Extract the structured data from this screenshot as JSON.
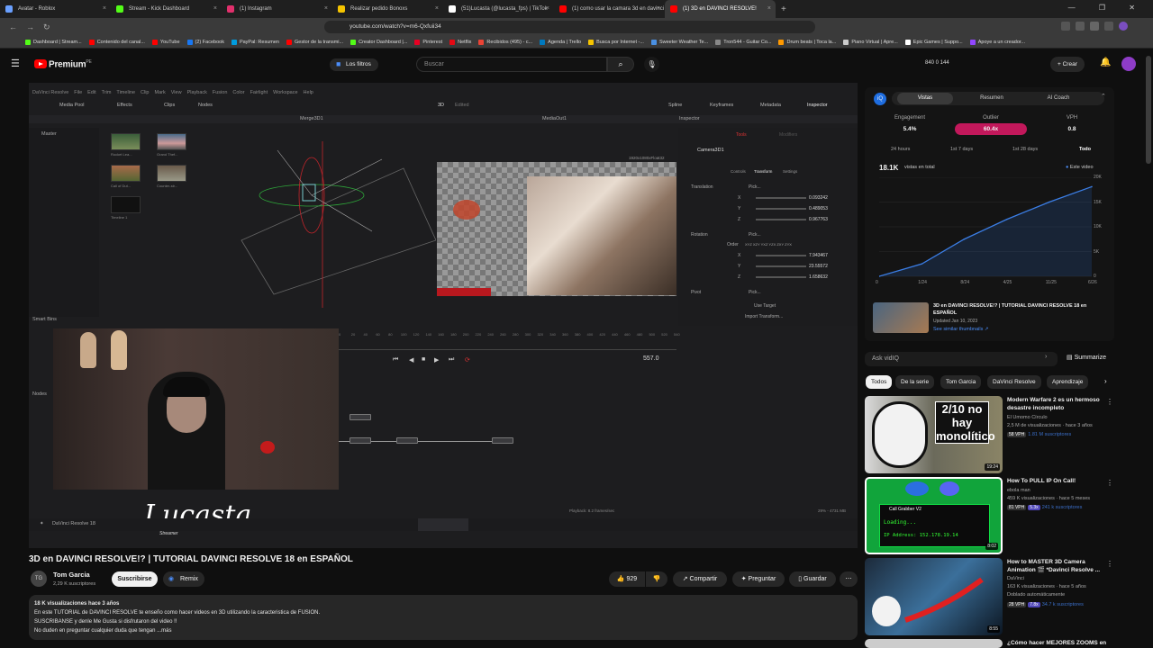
{
  "browser": {
    "tabs": [
      {
        "label": "Avatar - Roblox",
        "color": "#6aa0ff"
      },
      {
        "label": "Stream - Kick Dashboard",
        "color": "#53fc18"
      },
      {
        "label": "(1) Instagram",
        "color": "#e1306c"
      },
      {
        "label": "Realizar pedido Bonoxs",
        "color": "#f5c400"
      },
      {
        "label": "(51)Lucasta (@lucasta_fps) | TikTok",
        "color": "#ffffff"
      },
      {
        "label": "(1) como usar la camara 3d en davinci",
        "color": "#ff0000"
      },
      {
        "label": "(1) 3D en DAVINCI RESOLVE!",
        "color": "#ff0000",
        "active": true
      }
    ],
    "url": "youtube.com/watch?v=m6-Qxfuii34",
    "bookmarks": [
      {
        "label": "Dashboard | Stream...",
        "color": "#53fc18"
      },
      {
        "label": "Contenido del canal...",
        "color": "#ff0000"
      },
      {
        "label": "YouTube",
        "color": "#ff0000"
      },
      {
        "label": "(2) Facebook",
        "color": "#1877f2"
      },
      {
        "label": "PayPal: Resumen",
        "color": "#009cde"
      },
      {
        "label": "Gestor de la transmi...",
        "color": "#ff0000"
      },
      {
        "label": "Creator Dashboard |...",
        "color": "#53fc18"
      },
      {
        "label": "Pinterest",
        "color": "#e60023"
      },
      {
        "label": "Netflix",
        "color": "#e50914"
      },
      {
        "label": "Recibidos (495) - c...",
        "color": "#ea4335"
      },
      {
        "label": "Agenda | Trello",
        "color": "#0079bf"
      },
      {
        "label": "Busca por Internet -...",
        "color": "#f5c400"
      },
      {
        "label": "Sweeter Weather Te...",
        "color": "#4a90e2"
      },
      {
        "label": "Tron544 - Guitar Co...",
        "color": "#888888"
      },
      {
        "label": "Drum beats | Toca la...",
        "color": "#ff9900"
      },
      {
        "label": "Piano Virtual | Apre...",
        "color": "#cccccc"
      },
      {
        "label": "Epic Games | Suppo...",
        "color": "#ffffff"
      },
      {
        "label": "Apoye a un creador...",
        "color": "#9146ff"
      }
    ]
  },
  "youtube": {
    "brand": "Premium",
    "region": "PE",
    "filter_chip": "Los filtros",
    "search_placeholder": "Buscar",
    "stats": "840  0  144",
    "create_label": "Crear"
  },
  "resolve": {
    "menu": [
      "DaVinci Resolve",
      "File",
      "Edit",
      "Trim",
      "Timeline",
      "Clip",
      "Mark",
      "View",
      "Playback",
      "Fusion",
      "Color",
      "Fairlight",
      "Workspace",
      "Help"
    ],
    "toolbar": {
      "media_pool": "Media Pool",
      "effects": "Effects",
      "clips": "Clips",
      "nodes": "Nodes",
      "view3d": "3D",
      "edited": "Edited",
      "spline": "Spline",
      "keyframes": "Keyframes",
      "metadata": "Metadata",
      "inspector": "Inspector"
    },
    "viewer_left": "Merge3D1",
    "viewer_right": "MediaOut1",
    "resolution": "1920x1080xFloat32",
    "master": "Master",
    "smart_bins": "Smart Bins",
    "nodes_title": "Nodes",
    "clips": [
      "Rocket Lea...",
      "Grand Thef...",
      "Call of Dut...",
      "Counter-str...",
      "Timeline 1"
    ],
    "inspector": {
      "title": "Inspector",
      "tools_tab": "Tools",
      "modifiers_tab": "Modifiers",
      "node": "Camera3D1",
      "sub_tabs": [
        "Controls",
        "Transform",
        "Settings"
      ],
      "translation_label": "Translation",
      "translation": [
        "0.093242",
        "0.489053",
        "0.967763"
      ],
      "rotation_label": "Rotation",
      "order_label": "Order",
      "order_values": "XYZ  XZY  YXZ  YZX  ZXY  ZYX",
      "rotation": [
        "7.943467",
        "23.55572",
        "1.658632"
      ],
      "pivot_label": "Pivot",
      "use_target": "Use Target",
      "import_transform": "Import Transform...",
      "pick": "Pick..."
    },
    "timecode": "557.0",
    "playback_info": "Playback: 8.2 frames/sec",
    "mem_info": "29% - 4731 MB",
    "app_name": "DaVinci Resolve 18",
    "timeline_ticks": [
      "0",
      "20",
      "40",
      "60",
      "80",
      "100",
      "120",
      "140",
      "160",
      "180",
      "200",
      "220",
      "240",
      "260",
      "280",
      "300",
      "320",
      "340",
      "360",
      "380",
      "400",
      "420",
      "440",
      "460",
      "480",
      "500",
      "520",
      "540"
    ],
    "watermark_name": "Lucasta",
    "watermark_sub": "Streamer"
  },
  "video": {
    "title": "3D en DAVINCI RESOLVE!? | TUTORIAL DAVINCI RESOLVE 18 en ESPAÑOL",
    "channel": "Tom Garcia",
    "channel_initials": "TG",
    "subscribers": "2,29 K suscriptores",
    "subscribe_label": "Suscribirse",
    "remix_label": "Remix",
    "likes": "929",
    "share_label": "Compartir",
    "ask_label": "Preguntar",
    "save_label": "Guardar",
    "views_meta": "18 K visualizaciones  hace 3 años",
    "description_lines": [
      "En este TUTORIAL de DAVINCI RESOLVE te enseño como hacer videos en 3D utilizando la caracteristica de FUSION.",
      "SUSCRIBANSE y denle Me Gusta si disfrutaron del video !!",
      "No duden en preguntar cualquier duda que tengan ...más"
    ]
  },
  "vidiq": {
    "tabs": [
      "Vistas",
      "Resumen",
      "AI Coach"
    ],
    "metrics": [
      {
        "label": "Engagement",
        "value": "5.4%"
      },
      {
        "label": "Outlier",
        "value": "60.4x"
      },
      {
        "label": "VPH",
        "value": "0.8"
      }
    ],
    "ranges": [
      "24 hours",
      "1st 7 days",
      "1st 28 days",
      "Todo"
    ],
    "total_views": "18.1K",
    "views_label": "vistas en total",
    "this_video_label": "Este video",
    "accent": "#c2185b",
    "chart_data": {
      "type": "line",
      "title": "",
      "x": [
        "0",
        "1/24",
        "8/24",
        "4/25",
        "11/25",
        "6/26"
      ],
      "series": [
        {
          "name": "Este video",
          "values": [
            0,
            2500,
            7500,
            11500,
            15000,
            18100
          ]
        }
      ],
      "y_ticks": [
        "20K",
        "15K",
        "10K",
        "5K",
        "0"
      ],
      "ylim": [
        0,
        20000
      ],
      "grid": true
    },
    "video_card": {
      "title": "3D en DAVINCI RESOLVE!? | TUTORIAL DAVINCI RESOLVE 18 en ESPAÑOL",
      "updated": "Updated Jan 10, 2023",
      "link": "See similar thumbnails ↗"
    },
    "ask_placeholder": "Ask vidIQ",
    "summarize_label": "Summarize"
  },
  "sidebar_chips": [
    "Todos",
    "De la serie",
    "Tom Garcia",
    "DaVinci Resolve",
    "Aprendizaje"
  ],
  "recommendations": [
    {
      "title": "Modern Warfare 2 es un hermoso desastre incompleto",
      "channel": "El Umomo Círculo",
      "meta": "2,5 M de visualizaciones · hace 3 años",
      "vph": "58 VPH",
      "subs": "1.81 M suscriptores",
      "duration": "19:24",
      "thumb_text": "2/10 no hay monolítico"
    },
    {
      "title": "How To PULL IP On Call!",
      "channel": "ebola man",
      "meta": "459 K visualizaciones · hace 5 meses",
      "vph": "81 VPH",
      "subs": "241 k suscriptores",
      "badge": "5.3x",
      "duration": "8:02",
      "thumb_text": "Call Grabber V2",
      "thumb_line2": "Loading...",
      "thumb_line3": "IP Address: 152.178.19.14"
    },
    {
      "title": "How to MASTER 3D Camera Animation 🎬 *Davinci Resolve ...",
      "channel": "DaVinci",
      "meta": "163 K visualizaciones · hace 5 años",
      "dub": "Doblado automáticamente",
      "vph": "28 VPH",
      "subs": "34.7 k suscriptores",
      "badge": "7.8x",
      "duration": "8:55"
    },
    {
      "title": "¿Cómo hacer MEJORES ZOOMS en"
    }
  ]
}
